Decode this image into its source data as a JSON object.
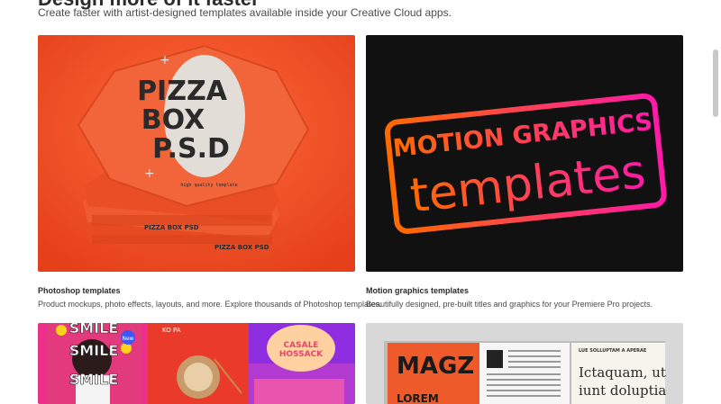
{
  "section": {
    "heading": "Design more of it faster",
    "subheading": "Create faster with artist-designed templates available inside your Creative Cloud apps."
  },
  "cards": [
    {
      "title": "Photoshop templates",
      "description": "Product mockups, photo effects, layouts, and more. Explore thousands of Photoshop templates.",
      "image": {
        "lines": [
          "PIZZA",
          "BOX",
          "P.S.D"
        ],
        "tagline": "high quality template",
        "band": "PIZZA BOX PSD"
      }
    },
    {
      "title": "Motion graphics templates",
      "description": "Beautifully designed, pre-built titles and graphics for your Premiere Pro projects.",
      "image": {
        "line1": "MOTION GRAPHICS",
        "line2": "templates"
      }
    },
    {
      "image": {
        "smile": "SMILE",
        "badge": "New",
        "kopa": "KO PA",
        "casale_line1": "CASALE",
        "casale_line2": "HOSSACK"
      }
    },
    {
      "image": {
        "magazine_title": "MAGZ",
        "magazine_sub": "LOREM",
        "right_heading": "LUE SOLLUPTAM A APERAE",
        "right_line1": "Ictaquam, ut",
        "right_line2": "iunt doluptia"
      }
    }
  ],
  "colors": {
    "pizza_bg": "#f04a20",
    "motion_bg": "#111111",
    "motion_gradient_start": "#ff6a00",
    "motion_gradient_end": "#ff1aa8",
    "mag_orange": "#ef5a2a"
  }
}
